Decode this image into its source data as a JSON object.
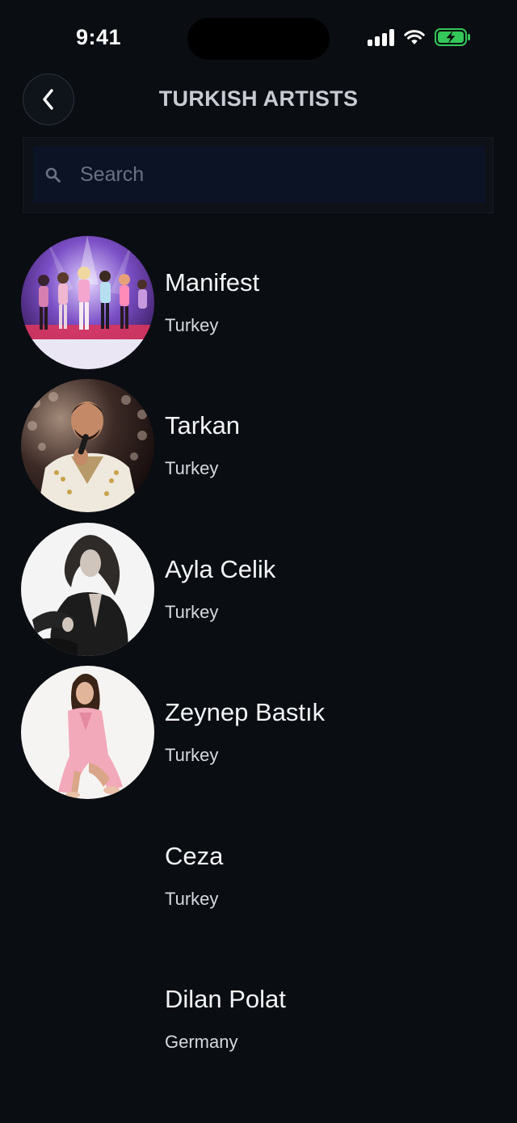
{
  "status_bar": {
    "time": "9:41"
  },
  "header": {
    "title": "TURKISH ARTISTS",
    "back_icon": "chevron-left-icon"
  },
  "search": {
    "placeholder": "Search",
    "value": "",
    "icon": "search-icon"
  },
  "colors": {
    "background": "#0a0d12",
    "search_field": "#0c1325",
    "battery_fill": "#34c759"
  },
  "artists": [
    {
      "name": "Manifest",
      "country": "Turkey",
      "has_avatar": true
    },
    {
      "name": "Tarkan",
      "country": "Turkey",
      "has_avatar": true
    },
    {
      "name": "Ayla Celik",
      "country": "Turkey",
      "has_avatar": true
    },
    {
      "name": "Zeynep Bastık",
      "country": "Turkey",
      "has_avatar": true
    },
    {
      "name": "Ceza",
      "country": "Turkey",
      "has_avatar": false
    },
    {
      "name": "Dilan Polat",
      "country": "Germany",
      "has_avatar": false
    }
  ]
}
